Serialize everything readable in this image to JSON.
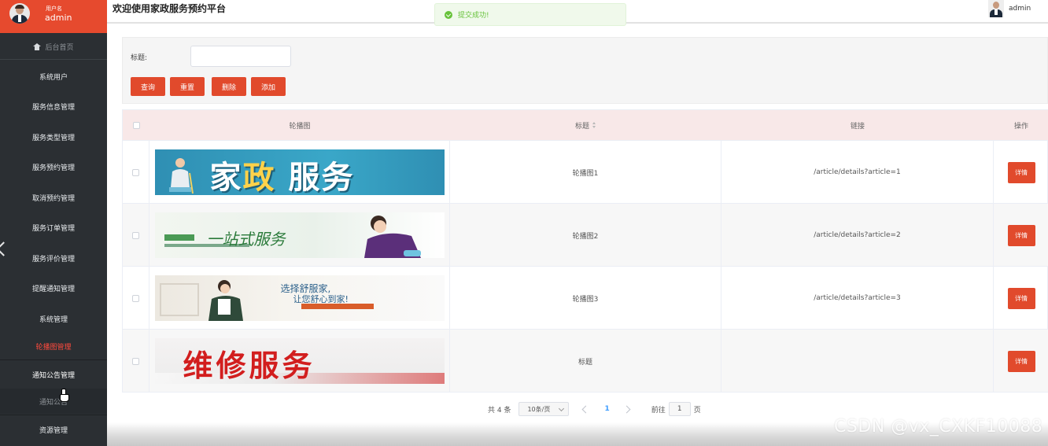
{
  "sidebar": {
    "user_caption": "用户名",
    "user_name": "admin",
    "home_label": "后台首页",
    "items": [
      {
        "label": "系统用户"
      },
      {
        "label": "服务信息管理"
      },
      {
        "label": "服务类型管理"
      },
      {
        "label": "服务预约管理"
      },
      {
        "label": "取消预约管理"
      },
      {
        "label": "服务订单管理"
      },
      {
        "label": "服务评价管理"
      },
      {
        "label": "提醒通知管理"
      },
      {
        "label": "系统管理"
      },
      {
        "label": "轮播图管理"
      },
      {
        "label": "通知公告管理"
      },
      {
        "label": "通知公告"
      },
      {
        "label": "资源管理"
      }
    ]
  },
  "header": {
    "title": "欢迎使用家政服务预约平台",
    "user": "admin"
  },
  "toast": {
    "message": "提交成功!",
    "color": "#67c23a"
  },
  "search": {
    "label": "标题:",
    "buttons": {
      "query": "查询",
      "reset": "重置",
      "delete": "删除",
      "add": "添加"
    }
  },
  "table": {
    "columns": {
      "image": "轮播图",
      "title": "标题",
      "link": "链接",
      "action": "操作"
    },
    "rows": [
      {
        "title": "轮播图1",
        "link": "/article/details?article=1",
        "action": "详情",
        "banner": {
          "text_a": "家",
          "text_b": "政",
          "text_c": " 服务"
        }
      },
      {
        "title": "轮播图2",
        "link": "/article/details?article=2",
        "action": "详情",
        "banner": {
          "text": "一站式服务"
        }
      },
      {
        "title": "轮播图3",
        "link": "/article/details?article=3",
        "action": "详情",
        "banner": {
          "text1": "选择舒服家,",
          "text2": "让您舒心到家!"
        }
      },
      {
        "title": "标题",
        "link": "",
        "action": "详情",
        "banner": {
          "text": "维修服务"
        }
      }
    ]
  },
  "pagination": {
    "total": "共 4 条",
    "page_size": "10条/页",
    "current_page": "1",
    "goto_label": "前往",
    "goto_value": "1",
    "suffix": "页"
  },
  "watermark": "CSDN @vx_CXKF10088",
  "colors": {
    "accent": "#e14a2c",
    "sidebar_bg": "#2b2f33",
    "active_menu": "#ff4a3d",
    "header_row_bg": "#f8e8e8"
  }
}
